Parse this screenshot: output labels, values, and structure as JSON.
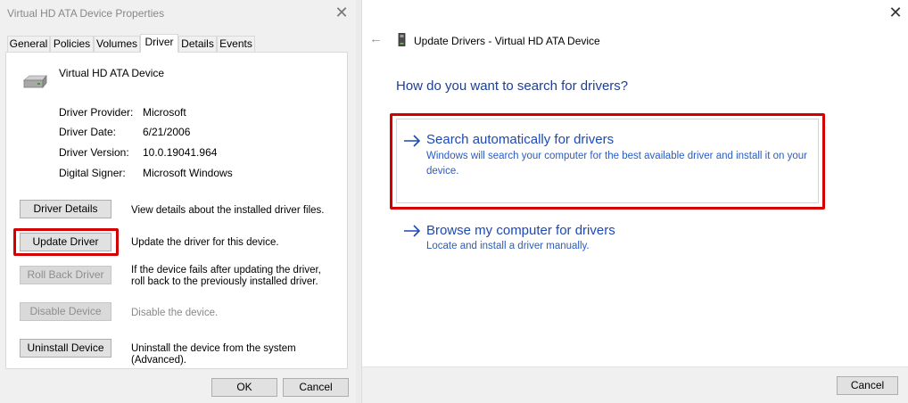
{
  "left_dialog": {
    "title": "Virtual HD ATA Device Properties",
    "tabs": [
      "General",
      "Policies",
      "Volumes",
      "Driver",
      "Details",
      "Events"
    ],
    "active_tab": "Driver",
    "device_name": "Virtual HD ATA Device",
    "properties": [
      {
        "label": "Driver Provider:",
        "value": "Microsoft"
      },
      {
        "label": "Driver Date:",
        "value": "6/21/2006"
      },
      {
        "label": "Driver Version:",
        "value": "10.0.19041.964"
      },
      {
        "label": "Digital Signer:",
        "value": "Microsoft Windows"
      }
    ],
    "actions": [
      {
        "label": "Driver Details",
        "desc": "View details about the installed driver files.",
        "enabled": true
      },
      {
        "label": "Update Driver",
        "desc": "Update the driver for this device.",
        "enabled": true
      },
      {
        "label": "Roll Back Driver",
        "desc": "If the device fails after updating the driver, roll back to the previously installed driver.",
        "enabled": false
      },
      {
        "label": "Disable Device",
        "desc": "Disable the device.",
        "enabled": false
      },
      {
        "label": "Uninstall Device",
        "desc": "Uninstall the device from the system (Advanced).",
        "enabled": true
      }
    ],
    "ok_label": "OK",
    "cancel_label": "Cancel",
    "close_glyph": "✕"
  },
  "right_dialog": {
    "title": "Update Drivers - Virtual HD ATA Device",
    "back_glyph": "←",
    "close_glyph": "✕",
    "heading": "How do you want to search for drivers?",
    "options": [
      {
        "title": "Search automatically for drivers",
        "desc": "Windows will search your computer for the best available driver and install it on your device."
      },
      {
        "title": "Browse my computer for drivers",
        "desc": "Locate and install a driver manually."
      }
    ],
    "cancel_label": "Cancel"
  },
  "colors": {
    "highlight": "#d40000",
    "link_blue": "#1c49b5",
    "heading_blue": "#1c3f95"
  },
  "icons": {
    "device": "hard-drive-icon",
    "wizard": "device-icon",
    "option_arrow": "arrow-right-icon"
  }
}
